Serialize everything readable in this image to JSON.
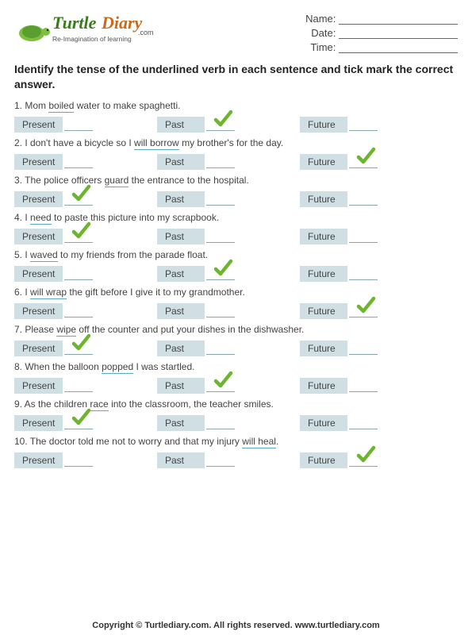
{
  "brand": {
    "name_part1": "Turtle",
    "name_part2": "Diary",
    "domain": ".com",
    "tagline": "Re-Imagination of learning"
  },
  "fields": {
    "name_label": "Name:",
    "date_label": "Date:",
    "time_label": "Time:"
  },
  "instructions": "Identify the tense of the underlined verb in each sentence and tick mark the correct answer.",
  "option_labels": {
    "present": "Present",
    "past": "Past",
    "future": "Future"
  },
  "questions": [
    {
      "num": "1.",
      "pre": "Mom ",
      "u": "boiled",
      "post": " water to make spaghetti.",
      "answer": "past"
    },
    {
      "num": "2.",
      "pre": "I don't have a bicycle so I ",
      "u": "will borrow",
      "post": " my brother's for the day.",
      "answer": "future"
    },
    {
      "num": "3.",
      "pre": "The police officers ",
      "u": "guard",
      "post": " the entrance to the hospital.",
      "answer": "present"
    },
    {
      "num": "4.",
      "pre": "I ",
      "u": "need",
      "post": " to paste this picture into my scrapbook.",
      "answer": "present"
    },
    {
      "num": "5.",
      "pre": "I ",
      "u": "waved",
      "post": " to my friends from the parade float.",
      "answer": "past"
    },
    {
      "num": "6.",
      "pre": "I ",
      "u": "will wrap",
      "post": " the gift before I give it to my grandmother.",
      "answer": "future"
    },
    {
      "num": "7.",
      "pre": "Please ",
      "u": "wipe",
      "post": " off the counter and put your dishes in the dishwasher.",
      "answer": "present"
    },
    {
      "num": "8.",
      "pre": "When the balloon ",
      "u": "popped",
      "post": " I was startled.",
      "answer": "past"
    },
    {
      "num": "9.",
      "pre": "As the children ",
      "u": "race",
      "post": " into the classroom, the teacher smiles.",
      "answer": "present"
    },
    {
      "num": "10.",
      "pre": "The doctor told me not to worry and that my injury ",
      "u": "will heal",
      "post": ".",
      "answer": "future"
    }
  ],
  "footer": "Copyright © Turtlediary.com. All rights reserved. www.turtlediary.com"
}
